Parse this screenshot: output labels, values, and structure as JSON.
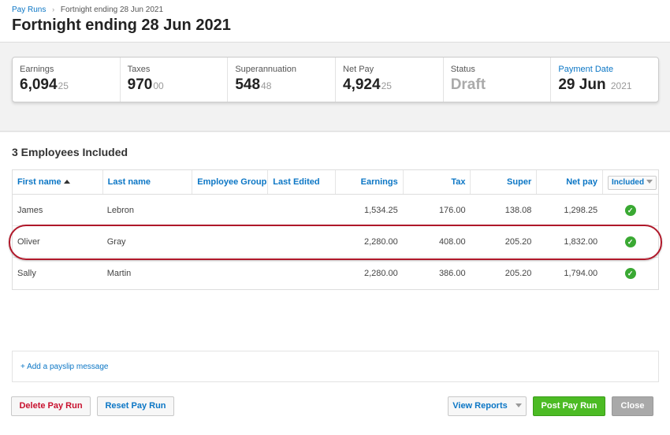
{
  "breadcrumb": {
    "parent": "Pay Runs",
    "separator": "›",
    "current": "Fortnight ending 28 Jun 2021"
  },
  "page_title": "Fortnight ending 28 Jun 2021",
  "summary": {
    "earnings": {
      "label": "Earnings",
      "whole": "6,094",
      "decimal": "25"
    },
    "taxes": {
      "label": "Taxes",
      "whole": "970",
      "decimal": "00"
    },
    "super": {
      "label": "Superannuation",
      "whole": "548",
      "decimal": "48"
    },
    "net_pay": {
      "label": "Net Pay",
      "whole": "4,924",
      "decimal": "25"
    },
    "status": {
      "label": "Status",
      "value": "Draft"
    },
    "payment_date": {
      "label": "Payment Date",
      "whole": "29 Jun",
      "decimal": "2021"
    }
  },
  "employees": {
    "title": "3 Employees Included",
    "columns": {
      "first_name": "First name",
      "last_name": "Last name",
      "group": "Employee Group",
      "last_edited": "Last Edited",
      "earnings": "Earnings",
      "tax": "Tax",
      "super": "Super",
      "net_pay": "Net pay",
      "included": "Included"
    },
    "rows": [
      {
        "first": "James",
        "last": "Lebron",
        "group": "",
        "edited": "",
        "earnings": "1,534.25",
        "tax": "176.00",
        "super": "138.08",
        "net": "1,298.25"
      },
      {
        "first": "Oliver",
        "last": "Gray",
        "group": "",
        "edited": "",
        "earnings": "2,280.00",
        "tax": "408.00",
        "super": "205.20",
        "net": "1,832.00"
      },
      {
        "first": "Sally",
        "last": "Martin",
        "group": "",
        "edited": "",
        "earnings": "2,280.00",
        "tax": "386.00",
        "super": "205.20",
        "net": "1,794.00"
      }
    ]
  },
  "payslip_message_link": "+ Add a payslip message",
  "buttons": {
    "delete": "Delete Pay Run",
    "reset": "Reset Pay Run",
    "view_reports": "View Reports",
    "post": "Post Pay Run",
    "close": "Close"
  },
  "icons": {
    "check": "check-circle-icon",
    "sort": "sort-ascending-icon"
  },
  "colors": {
    "accent": "#0b76c5",
    "success": "#3aa933",
    "danger": "#c8102e",
    "highlight": "#b0182a"
  }
}
